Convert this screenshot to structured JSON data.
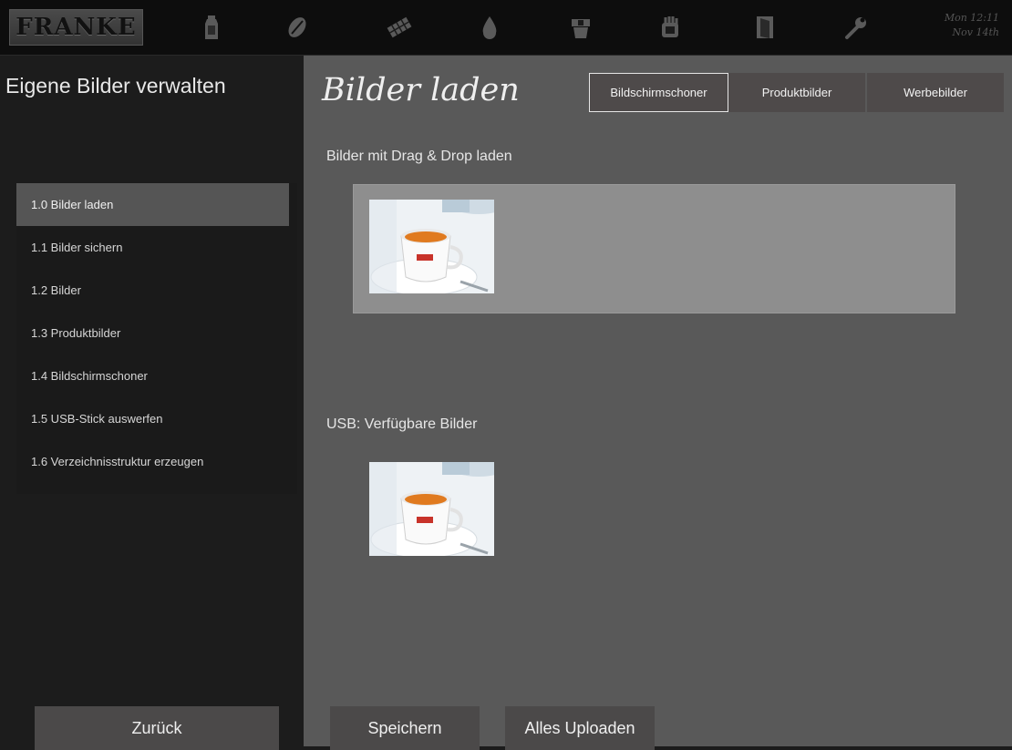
{
  "header": {
    "logo": "FRANKE",
    "icons": [
      "milk-carton-icon",
      "coffee-bean-icon",
      "chocolate-bar-icon",
      "water-drop-icon",
      "cup-stack-icon",
      "cleaning-hand-icon",
      "door-icon",
      "wrench-icon"
    ],
    "day_time": "Mon 12:11",
    "date": "Nov 14th"
  },
  "sidebar": {
    "title": "Eigene Bilder verwalten",
    "items": [
      {
        "label": "1.0 Bilder laden",
        "active": true
      },
      {
        "label": "1.1 Bilder sichern"
      },
      {
        "label": "1.2 Bilder"
      },
      {
        "label": "1.3 Produktbilder"
      },
      {
        "label": "1.4 Bildschirmschoner"
      },
      {
        "label": "1.5 USB-Stick auswerfen"
      },
      {
        "label": "1.6 Verzeichnisstruktur erzeugen"
      }
    ],
    "back_label": "Zurück"
  },
  "main": {
    "title": "Bilder laden",
    "tabs": [
      {
        "label": "Bildschirmschoner",
        "selected": true
      },
      {
        "label": "Produktbilder"
      },
      {
        "label": "Werbebilder"
      }
    ],
    "dropzone_label": "Bilder mit Drag & Drop laden",
    "usb_label": "USB: Verfügbare Bilder",
    "save_label": "Speichern",
    "upload_all_label": "Alles Uploaden"
  },
  "colors": {
    "background": "#1c1c1c",
    "panel": "#595959",
    "dropzone": "#8e8e8e",
    "button": "#4b4949",
    "active_item": "#555555",
    "accent_brand_red": "#c8332a"
  }
}
